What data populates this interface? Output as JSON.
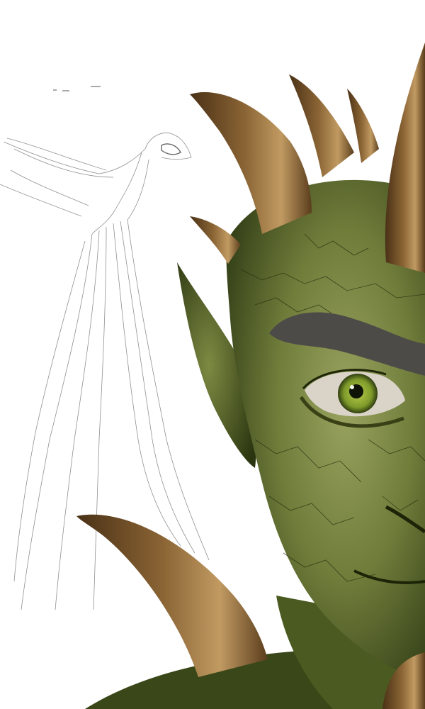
{
  "scene": {
    "subject": "goblin-portrait",
    "sketch": "bird-pencil-sketch",
    "palette": {
      "background": "#ffffff",
      "skin_dark": "#3c4a1e",
      "skin_mid": "#6f7c3a",
      "skin_light": "#9aa360",
      "horn_dark": "#4a3116",
      "horn_mid": "#8a6434",
      "horn_light": "#c19a62",
      "brow": "#4d4b48",
      "iris": "#7e9a2a",
      "pupil": "#0e1406",
      "sclera": "#d9d3c8",
      "sketch_line": "#6b6b6b"
    }
  }
}
